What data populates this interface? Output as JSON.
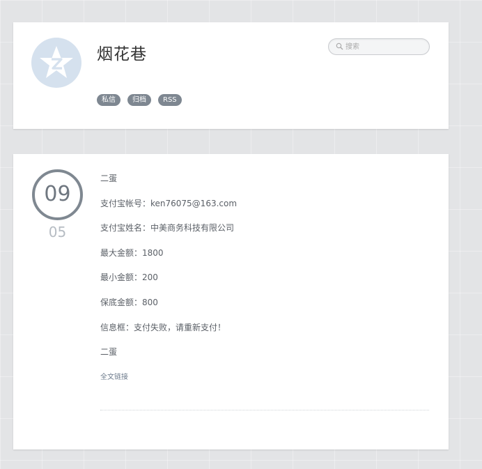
{
  "header": {
    "title": "烟花巷",
    "avatar_icon": "qzone-star-icon",
    "search": {
      "placeholder": "搜索",
      "icon": "search-icon"
    },
    "tags": [
      "私信",
      "归档",
      "RSS"
    ]
  },
  "post": {
    "date": {
      "day": "09",
      "month": "05"
    },
    "lines": [
      "二蛋",
      "支付宝帐号：ken76075@163.com",
      "支付宝姓名：中美商务科技有限公司",
      "最大金额：1800",
      "最小金额：200",
      "保底金额：800",
      "信息框：支付失败，请重新支付！",
      "二蛋"
    ],
    "full_link": "全文链接"
  },
  "colors": {
    "background": "#e3e4e6",
    "card": "#ffffff",
    "tag_bg": "#7e8791",
    "date_circle": "#7f8891",
    "avatar_bg": "#d5e1ee"
  }
}
